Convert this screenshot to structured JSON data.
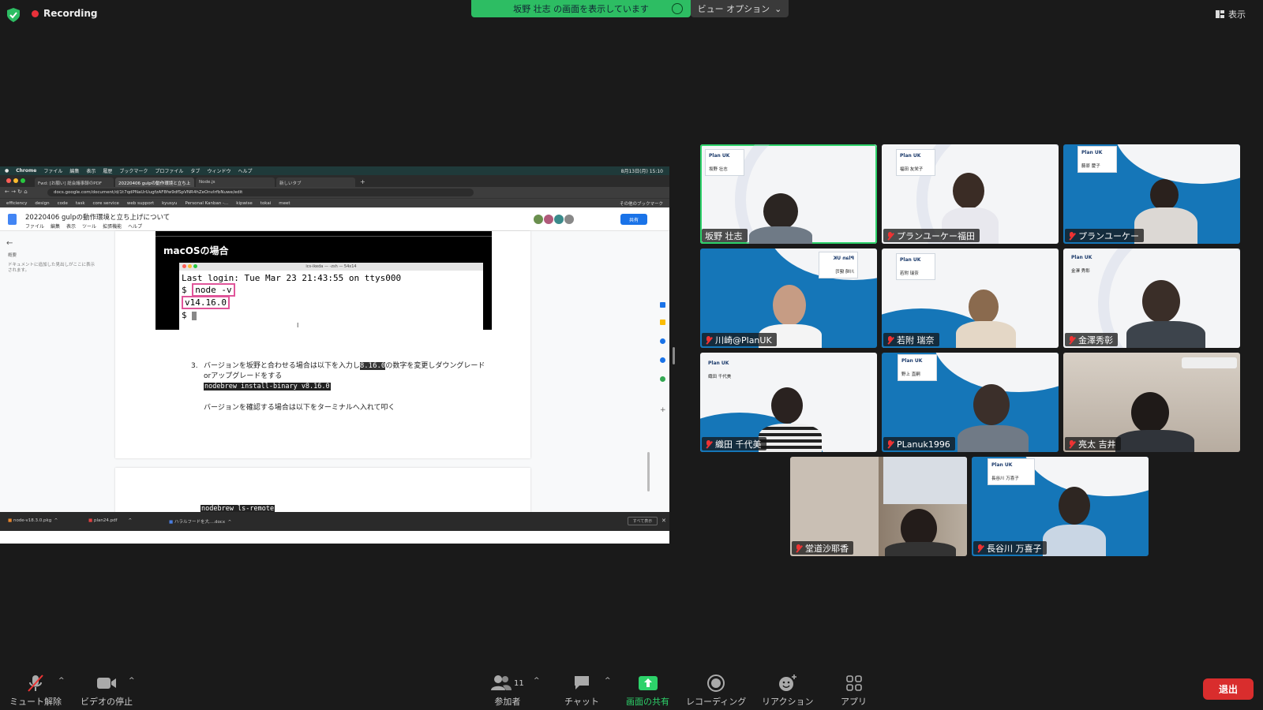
{
  "top": {
    "recording_label": "Recording",
    "viewing_banner": "坂野 壮志 の画面を表示しています",
    "view_options": "ビュー オプション",
    "display_label": "表示"
  },
  "shared_screen": {
    "mac_menu": [
      "Chrome",
      "ファイル",
      "編集",
      "表示",
      "履歴",
      "ブックマーク",
      "プロファイル",
      "タブ",
      "ウィンドウ",
      "ヘルプ"
    ],
    "mac_clock": "8月13日(月) 15:10",
    "tabs": [
      {
        "label": "Fwd: [お願い] 総会議事録のPDF"
      },
      {
        "label": "20220406 gulpの動作環境と立ち上"
      },
      {
        "label": "Node.js"
      },
      {
        "label": "新しいタブ"
      }
    ],
    "address": "docs.google.com/document/d/1t7qdPNaUrUugfzAF8fw9dfSpVNR4hZeOnvIrfbNuwe/edit",
    "bookmarks": [
      "efficiency",
      "design",
      "code",
      "task",
      "core service",
      "web support",
      "kyusyu",
      "Personal Kanban -...",
      "kipwise",
      "tokai",
      "meet"
    ],
    "bookmarks_other": "その他のブックマーク",
    "doc_title": "20220406 gulpの動作環境と立ち上げについて",
    "doc_menu": [
      "ファイル",
      "編集",
      "表示",
      "ツール",
      "拡張機能",
      "ヘルプ"
    ],
    "share_label": "共有",
    "outline_label": "概要",
    "outline_note": "ドキュメントに追加した見出しがここに表示されます。",
    "mac_heading": "macOSの場合",
    "terminal_title": "ics-ikeda — -zsh — 54x14",
    "terminal_lines": {
      "l1": "Last login: Tue Mar 23 21:43:55 on ttys000",
      "prompt": "$",
      "cmd": "node -v",
      "version": "v14.16.0"
    },
    "step_number": "3.",
    "step_text_before": "バージョンを坂野と合わせる場合は以下を入力し",
    "step_highlight": "8.16.0",
    "step_text_after": "の数字を変更しダウングレードorアップグレードをする",
    "cmd_install": "nodebrew install-binary v8.16.0",
    "check_text": "バージョンを確認する場合は以下をターミナルへ入れて叩く",
    "cmd_ls": "nodebrew ls-remote",
    "downloads": [
      "node-v18.3.0.pkg",
      "plan24.pdf",
      "ハラルフードを大....docx"
    ],
    "show_all": "すべて表示"
  },
  "participants": [
    {
      "name": "坂野 壮志",
      "card": "坂野 壮志",
      "muted": false,
      "bg": "white",
      "active": true
    },
    {
      "name": "プランユーケー福田",
      "card": "福田 友栄子",
      "muted": true,
      "bg": "white",
      "active": false
    },
    {
      "name": "プランユーケー",
      "card": "藤原 慶子",
      "muted": true,
      "bg": "blue",
      "active": false
    },
    {
      "name": "川崎@PlanUK",
      "card": "川崎 健司",
      "muted": true,
      "bg": "blue",
      "active": false
    },
    {
      "name": "若附 瑞奈",
      "card": "若附 瑞奈",
      "muted": true,
      "bg": "white",
      "active": false
    },
    {
      "name": "金澤秀彰",
      "card": "金澤 秀彰",
      "muted": true,
      "bg": "white",
      "active": false
    },
    {
      "name": "織田 千代美",
      "card": "織田 千代美",
      "muted": true,
      "bg": "white",
      "active": false
    },
    {
      "name": "PLanuk1996",
      "card": "野上 直嗣",
      "muted": true,
      "bg": "blue",
      "active": false
    },
    {
      "name": "亮太 吉井",
      "card": "",
      "muted": true,
      "bg": "room",
      "active": false
    },
    {
      "name": "堂道沙耶香",
      "card": "",
      "muted": true,
      "bg": "room",
      "active": false
    },
    {
      "name": "長谷川 万喜子",
      "card": "長谷川 万喜子",
      "muted": true,
      "bg": "blue",
      "active": false
    }
  ],
  "brand_logo": "Plan UK",
  "toolbar": {
    "unmute": "ミュート解除",
    "stop_video": "ビデオの停止",
    "participants": "参加者",
    "participant_count": "11",
    "chat": "チャット",
    "share": "画面の共有",
    "recording": "レコーディング",
    "reactions": "リアクション",
    "apps": "アプリ",
    "leave": "退出"
  },
  "colors": {
    "accent_green": "#2dbd63",
    "leave_red": "#d92d2d",
    "plan_blue": "#1576b8"
  }
}
